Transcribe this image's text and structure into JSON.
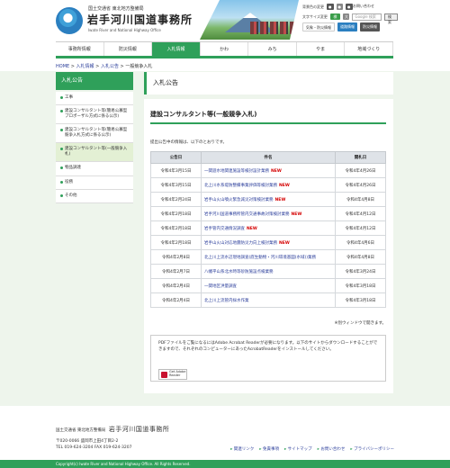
{
  "header": {
    "org_small": "国土交通省 東北地方整備局",
    "site_title": "岩手河川国道事務所",
    "site_sub": "Iwate River and National Highway Office",
    "contact": "お問い合わせ",
    "font_size_label": "文字サイズ変更",
    "color_label": "背景色の変更",
    "search_placeholder": "Google 検索",
    "search_button": "検索",
    "banner1": "気象・防災情報",
    "banner2": "道路情報",
    "banner3": "防災情報"
  },
  "gnav": {
    "items": [
      "事務所情報",
      "防災情報",
      "入札情報",
      "かわ",
      "みち",
      "やま",
      "地域づくり"
    ]
  },
  "breadcrumb": {
    "home": "HOME",
    "l1": "入札情報",
    "l2": "入札公告",
    "current": "一般競争入札"
  },
  "sidebar": {
    "title": "入札公告",
    "items": [
      "工事",
      "建設コンサルタント等(簡易公募型プロポーザル方式に係る公示)",
      "建設コンサルタント等(簡易公募型競争入札方式に係る公示)",
      "建設コンサルタント等(一般競争入札)",
      "物品調達",
      "役務",
      "その他"
    ]
  },
  "main": {
    "heading": "入札公告",
    "section_title": "建設コンサルタント等(一般競争入札)",
    "intro": "提出公告中の情報は、以下のとおりです。",
    "col_date": "公告日",
    "col_name": "件名",
    "col_due": "開札日",
    "new_label": "NEW",
    "rows": [
      {
        "date": "令和4年3月15日",
        "name": "一関遊水地関連施設等検討設計業務",
        "new": true,
        "due": "令和4年4月26日"
      },
      {
        "date": "令和4年3月15日",
        "name": "北上川水系堤防整備事業評価等検討業務",
        "new": true,
        "due": "令和4年4月26日"
      },
      {
        "date": "令和4年2月24日",
        "name": "岩手山火山噴火緊急減災対策検討業務",
        "new": true,
        "due": "令和4年4月8日"
      },
      {
        "date": "令和4年2月18日",
        "name": "岩手河川国道事務所管内交通事故対策検討業務",
        "new": true,
        "due": "令和4年4月12日"
      },
      {
        "date": "令和4年2月18日",
        "name": "岩手管内交通情況調査",
        "new": true,
        "due": "令和4年4月12日"
      },
      {
        "date": "令和4年2月18日",
        "name": "岩手山火山対応地震防災力向上検討業務",
        "new": true,
        "due": "令和4年4月6日"
      },
      {
        "date": "令和4年2月8日",
        "name": "北上川上流水辺現地調査(底生動物・河川環境基図(水域))業務",
        "new": false,
        "due": "令和4年4月8日"
      },
      {
        "date": "令和4年2月7日",
        "name": "八幡平山系北水時等砂防施設点検業務",
        "new": false,
        "due": "令和4年3月24日"
      },
      {
        "date": "令和4年2月4日",
        "name": "一関地区洪量調査",
        "new": false,
        "due": "令和4年3月18日"
      },
      {
        "date": "令和4年2月4日",
        "name": "北上川上流管内採水作業",
        "new": false,
        "due": "令和4年3月18日"
      }
    ],
    "note": "※別ウィンドウで開きます。",
    "pdf_text": "PDFファイルをご覧になるにはAdobe Acrobat Readerが必要になります。以下のサイトからダウンロードすることができますので、それぞれのコンピューターにあったAcrobatReaderをインストールしてください。",
    "adobe_badge": "Get Adobe Reader"
  },
  "footer": {
    "org_small": "国土交通省 東北地方整備局",
    "org_name": "岩手河川国道事務所",
    "address": "〒020-0066 盛岡市上田4丁目2-2",
    "tel": "TEL 019-624-3204 FAX 019-624-3207",
    "links": [
      "関連リンク",
      "免責事項",
      "サイトマップ",
      "お問い合わせ",
      "プライバシーポリシー"
    ],
    "copyright": "Copyright(c) Iwate River and National Highway Office. All Rights Reserved."
  }
}
